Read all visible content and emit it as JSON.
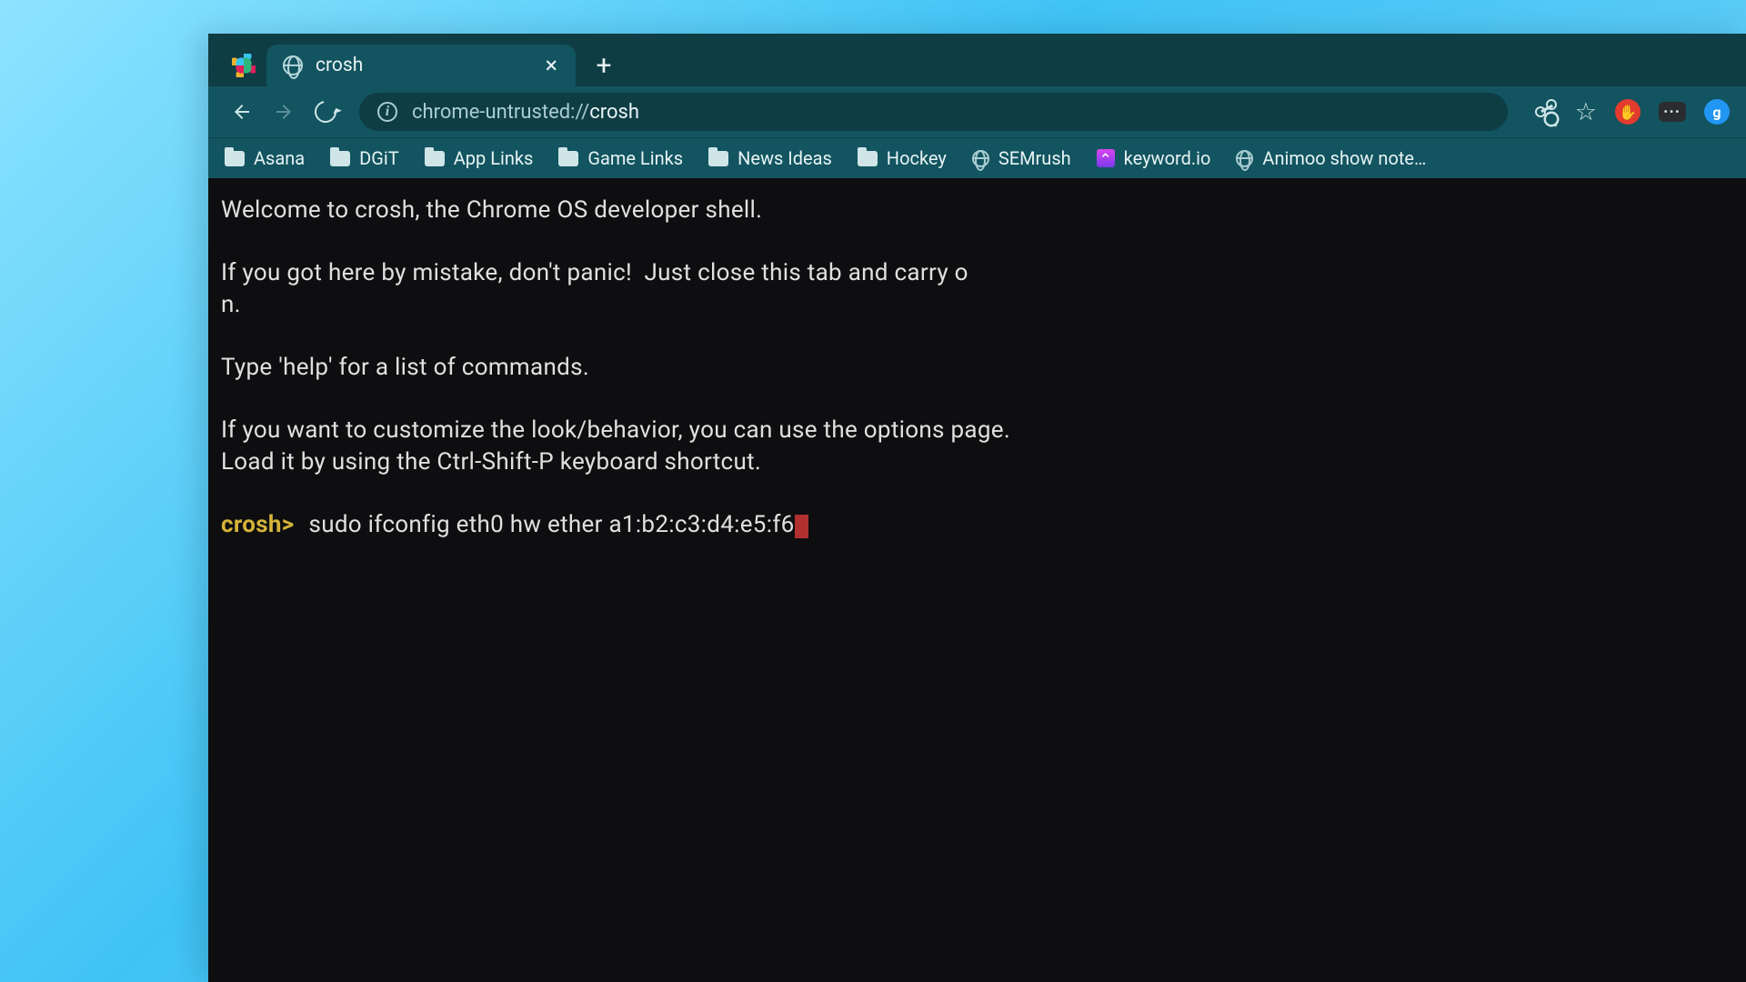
{
  "tab": {
    "title": "crosh"
  },
  "url": {
    "scheme": "chrome-untrusted://",
    "path": "crosh"
  },
  "bookmarks": [
    {
      "type": "folder",
      "label": "Asana"
    },
    {
      "type": "folder",
      "label": "DGiT"
    },
    {
      "type": "folder",
      "label": "App Links"
    },
    {
      "type": "folder",
      "label": "Game Links"
    },
    {
      "type": "folder",
      "label": "News Ideas"
    },
    {
      "type": "folder",
      "label": "Hockey"
    },
    {
      "type": "globe",
      "label": "SEMrush"
    },
    {
      "type": "keyword",
      "label": "keyword.io"
    },
    {
      "type": "globe",
      "label": "Animoo show note…"
    }
  ],
  "terminal": {
    "welcome_l1": "Welcome to crosh, the Chrome OS developer shell.",
    "welcome_l2": "If you got here by mistake, don't panic!  Just close this tab and carry o",
    "welcome_l3": "n.",
    "welcome_l4": "Type 'help' for a list of commands.",
    "welcome_l5": "If you want to customize the look/behavior, you can use the options page.",
    "welcome_l6": "Load it by using the Ctrl-Shift-P keyboard shortcut.",
    "prompt": "crosh>",
    "command": "sudo ifconfig eth0 hw ether a1:b2:c3:d4:e5:f6"
  },
  "extensions": {
    "red_glyph": "✋",
    "dots_glyph": "•••",
    "blue_glyph": "g"
  }
}
